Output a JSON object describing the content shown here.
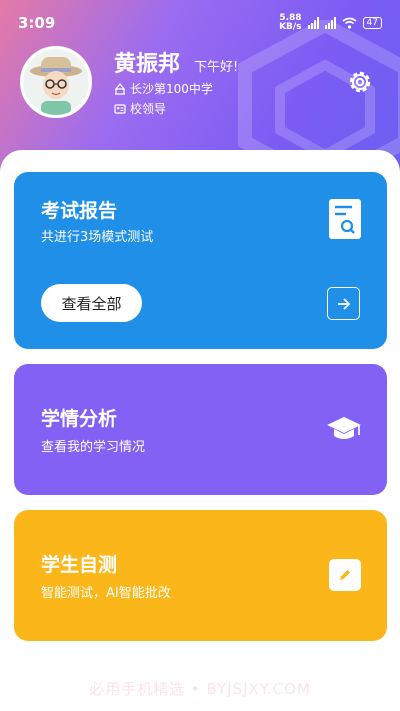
{
  "status_bar": {
    "time": "3:09",
    "net_speed_value": "5.88",
    "net_speed_unit": "KB/s",
    "battery": "47",
    "icons": [
      "hd-signal-icon",
      "hd-signal-icon",
      "wifi-icon",
      "battery-icon"
    ]
  },
  "profile": {
    "name": "黄振邦",
    "greeting": "下午好!",
    "school": "长沙第100中学",
    "role": "校领导"
  },
  "cards": {
    "report": {
      "title": "考试报告",
      "subtitle": "共进行3场模式测试",
      "button_label": "查看全部",
      "icon": "document-search-icon"
    },
    "analysis": {
      "title": "学情分析",
      "subtitle": "查看我的学习情况",
      "icon": "graduation-cap-icon"
    },
    "self_test": {
      "title": "学生自测",
      "subtitle": "智能测试，AI智能批改",
      "icon": "edit-icon"
    }
  },
  "watermark": "必用手机精选 • BYJSJXY.COM",
  "colors": {
    "report_card": "#1f8fe8",
    "analysis_card": "#8461f5",
    "self_test_card": "#fbb71a",
    "header_gradient_start": "#e57aa6",
    "header_gradient_end": "#6a60f0"
  }
}
